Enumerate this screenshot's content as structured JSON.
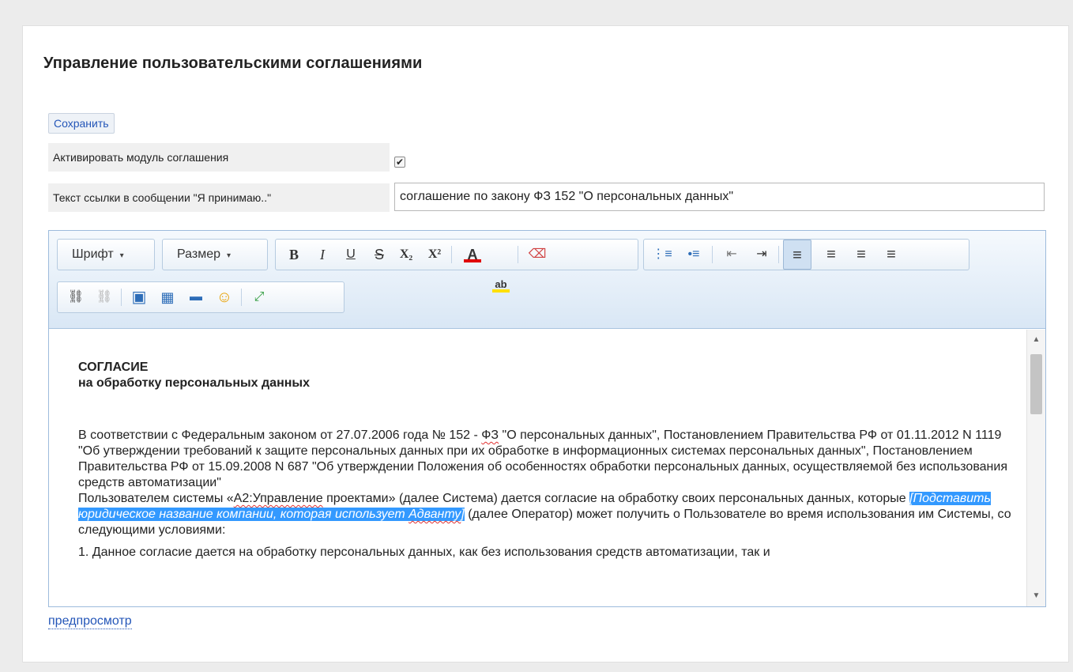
{
  "page": {
    "title": "Управление пользовательскими соглашениями"
  },
  "toolbar": {
    "save_label": "Сохранить"
  },
  "form": {
    "activate_label": "Активировать модуль соглашения",
    "activate_checked_glyph": "✔",
    "link_text_label": "Текст ссылки в сообщении \"Я принимаю..\"",
    "link_text_value": "соглашение по закону ФЗ 152 \"О персональных данных\""
  },
  "editor": {
    "font_combo": "Шрифт",
    "size_combo": "Размер",
    "combo_arrow": "▾",
    "buttons": {
      "bold": "B",
      "italic": "I",
      "underline": "U",
      "strike": "S",
      "subscript": "X₂",
      "superscript": "X²",
      "font_color": "A",
      "highlight": "ab",
      "eraser": "⌫",
      "ordered_list": "⋮≡",
      "bullet_list": "•≡",
      "outdent": "⇤",
      "indent": "⇥",
      "align_left": "≡",
      "align_center": "≡",
      "align_right": "≡",
      "align_justify": "≡",
      "link": "⛓",
      "unlink": "⛓",
      "image": "▣",
      "table": "▦",
      "hr": "▬",
      "smiley": "☺",
      "fullscreen": "⤢"
    },
    "content": {
      "title_line1": "СОГЛАСИЕ",
      "title_line2": "на обработку персональных данных",
      "p1": "В соответствии с Федеральным законом от   27.07.2006  года  № 152 - ",
      "p1_fz": "ФЗ",
      "p1_rest": " \"О персональных данных\", Постановлением Правительства РФ от 01.11.2012 N 1119 \"Об утверждении требований к защите персональных данных при их обработке в информационных системах персональных данных\", Постановлением Правительства РФ от 15.09.2008 N 687 \"Об утверждении Положения об особенностях обработки персональных данных, осуществляемой без использования средств автоматизации\"",
      "p2_start": "Пользователем системы «",
      "p2_system": "А2:Управление",
      "p2_mid": " проектами» (далее Система) дается согласие на обработку своих персональных данных, которые ",
      "p2_highlight_start": "[Подставить юридическое название компании, которая использует ",
      "p2_highlight_word": "Адванту",
      "p2_highlight_end": "]",
      "p2_end": " (далее Оператор) может получить о Пользователе во время использования им Системы, со следующими условиями:",
      "p3": "1. Данное согласие дается на обработку персональных данных, как без использования средств автоматизации, так и"
    },
    "scroll_up": "▲",
    "scroll_down": "▼"
  },
  "footer": {
    "preview_link": "предпросмотр"
  },
  "colors": {
    "accent_link": "#2456b8",
    "selection": "#3399ff",
    "toolbar_border": "#9dbbdc"
  }
}
